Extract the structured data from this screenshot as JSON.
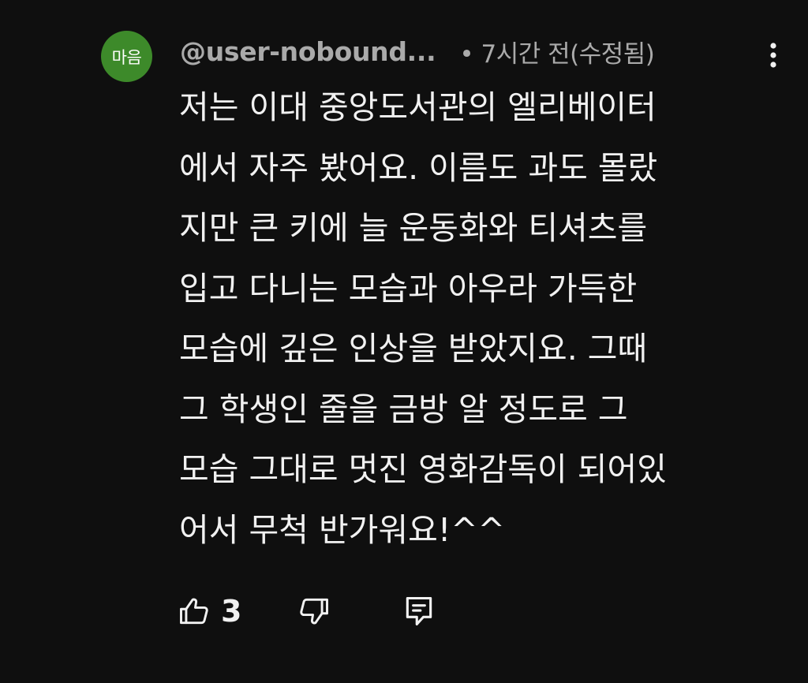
{
  "comment": {
    "avatar_text": "마음",
    "avatar_color": "#3d8a2a",
    "username": "@user-nobound...",
    "meta": "• 7시간 전(수정됨)",
    "text": "저는 이대 중앙도서관의  엘리베이터\n에서 자주 봤어요. 이름도 과도 몰랐\n지만 큰 키에 늘 운동화와 티셔츠를\n입고 다니는 모습과 아우라 가득한\n모습에 깊은 인상을 받았지요. 그때\n그 학생인 줄을 금방 알 정도로  그\n모습 그대로 멋진 영화감독이 되어있\n어서 무척 반가워요!^^",
    "like_count": "3",
    "icons": {
      "more": "more-vert-icon",
      "like": "thumb-up-icon",
      "dislike": "thumb-down-icon",
      "reply": "reply-comment-icon"
    }
  }
}
